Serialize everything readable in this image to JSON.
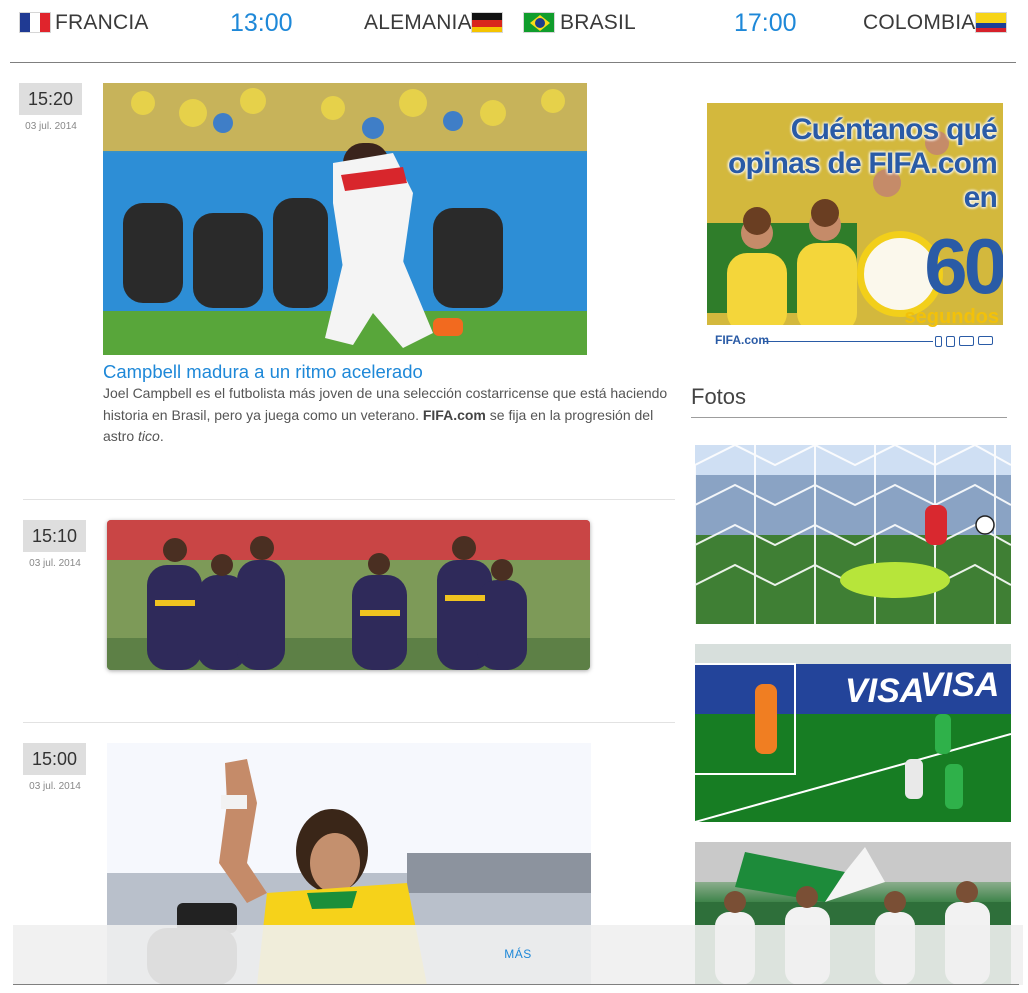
{
  "ticker": {
    "matches": [
      {
        "home": "FRANCIA",
        "time": "13:00",
        "away": "ALEMANIA"
      },
      {
        "home": "BRASIL",
        "time": "17:00",
        "away": "COLOMBIA"
      }
    ]
  },
  "feed": {
    "items": [
      {
        "time": "15:20",
        "date": "03 jul. 2014",
        "headline": "Campbell madura a un ritmo acelerado",
        "summary_1": "Joel Campbell es el futbolista más joven de una selección costarricense que está haciendo historia en Brasil, pero ya juega como un veterano. ",
        "summary_brand": "FIFA.com",
        "summary_2": " se fija en la progresión del astro ",
        "summary_italic": "tico",
        "summary_end": "."
      },
      {
        "time": "15:10",
        "date": "03 jul. 2014"
      },
      {
        "time": "15:00",
        "date": "03 jul. 2014"
      }
    ]
  },
  "sidebar": {
    "ad": {
      "line1": "Cuéntanos qué",
      "line2": "opinas de FIFA.com",
      "line3": "en",
      "number": "60",
      "unit": "segundos",
      "brand": "FIFA.com"
    },
    "photos_title": "Fotos"
  },
  "load_more": {
    "label": "MÁS"
  },
  "colors": {
    "accent": "#1e88d8",
    "badge_bg": "#dedede",
    "ad_blue": "#2a5ba6",
    "ad_yellow": "#f2c10a"
  }
}
